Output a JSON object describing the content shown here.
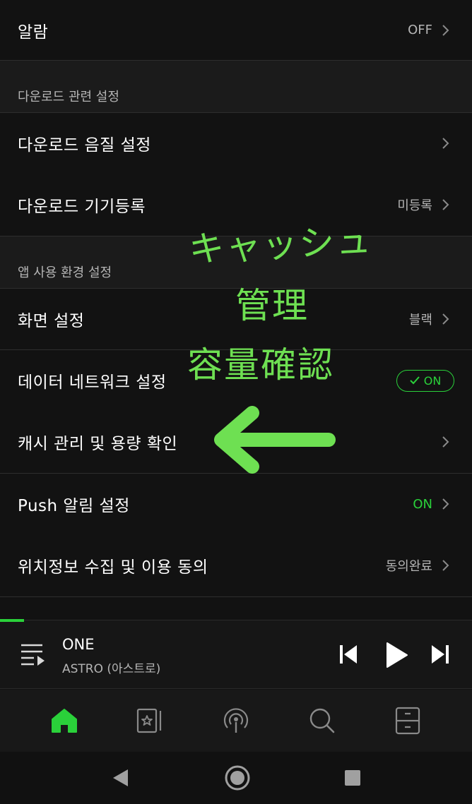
{
  "rows": {
    "alarm": {
      "label": "알람",
      "value": "OFF"
    },
    "download_quality": {
      "label": "다운로드 음질 설정"
    },
    "download_device": {
      "label": "다운로드 기기등록",
      "value": "미등록"
    },
    "screen": {
      "label": "화면 설정",
      "value": "블랙"
    },
    "data_network": {
      "label": "데이터 네트워크 설정",
      "toggle": "ON"
    },
    "cache": {
      "label": "캐시 관리 및 용량 확인"
    },
    "push": {
      "label": "Push 알림 설정",
      "value": "ON"
    },
    "location": {
      "label": "위치정보 수집 및 이용 동의",
      "value": "동의완료"
    }
  },
  "sections": {
    "download": "다운로드 관련 설정",
    "app_env": "앱 사용 환경 설정"
  },
  "annotation": {
    "line1": "キャッシュ",
    "line2": "管理",
    "line3": "容量確認"
  },
  "player": {
    "title": "ONE",
    "artist": "ASTRO (아스트로)"
  },
  "colors": {
    "accent": "#2ad13a",
    "annotation": "#6ee052",
    "background": "#121212"
  }
}
